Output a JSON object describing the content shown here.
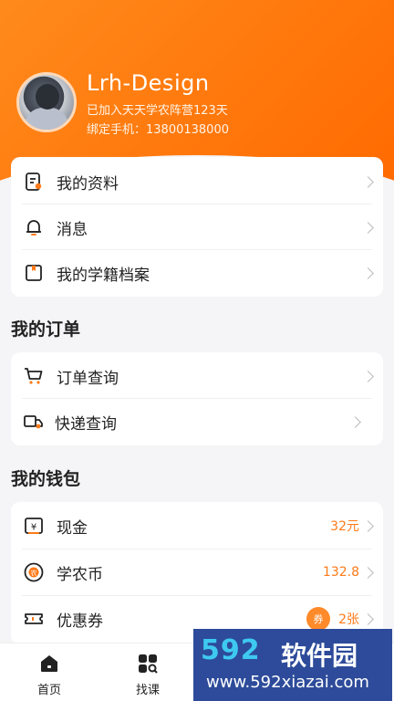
{
  "profile": {
    "name": "Lrh-Design",
    "joined": "已加入天天学农阵营123天",
    "phone": "绑定手机：13800138000"
  },
  "account_menu": [
    {
      "label": "我的资料",
      "icon": "profile-doc-icon"
    },
    {
      "label": "消息",
      "icon": "bell-icon"
    },
    {
      "label": "我的学籍档案",
      "icon": "archive-icon"
    }
  ],
  "orders": {
    "title": "我的订单",
    "items": [
      {
        "label": "订单查询",
        "icon": "cart-icon"
      },
      {
        "label": "快递查询",
        "icon": "truck-icon"
      }
    ]
  },
  "wallet": {
    "title": "我的钱包",
    "items": [
      {
        "label": "现金",
        "value": "32元",
        "icon": "yen-icon"
      },
      {
        "label": "学农币",
        "value": "132.8",
        "icon": "coin-icon"
      },
      {
        "label": "优惠券",
        "value": "2张",
        "badge": "券",
        "icon": "ticket-icon"
      }
    ]
  },
  "tabbar": [
    {
      "label": "首页",
      "icon": "home-icon"
    },
    {
      "label": "找课",
      "icon": "grid-search-icon"
    }
  ],
  "watermark": {
    "brand_num": "592",
    "brand_cn": "软件园",
    "url": "www.592xiazai.com"
  },
  "colors": {
    "accent": "#ff7a18",
    "hero": "#ff6a00",
    "watermark_bg": "#2d4b9a"
  }
}
